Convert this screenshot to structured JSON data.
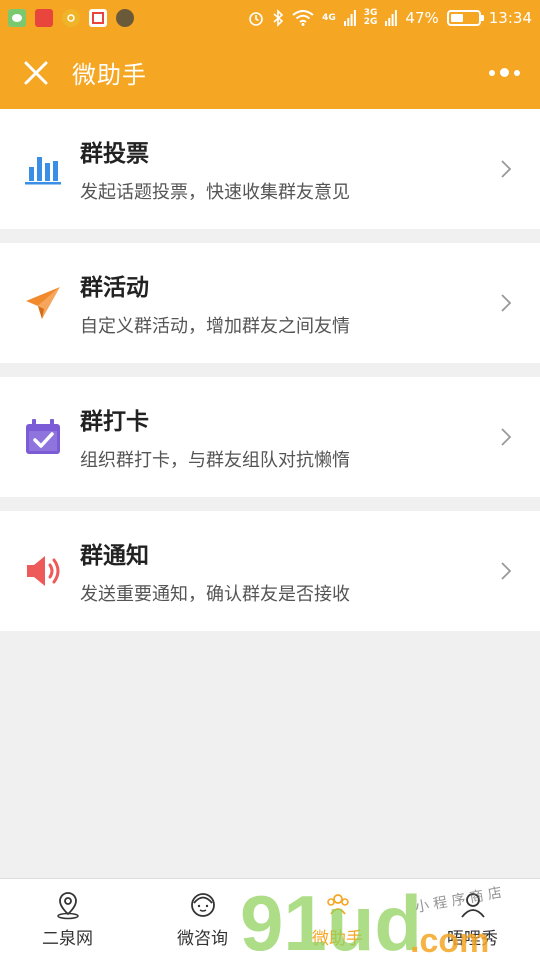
{
  "status_bar": {
    "battery": "47%",
    "battery_level": 0.47,
    "time": "13:34",
    "network1": "4G",
    "network2_top": "3G",
    "network2_bottom": "2G"
  },
  "nav": {
    "title": "微助手"
  },
  "items": [
    {
      "title": "群投票",
      "subtitle": "发起话题投票，快速收集群友意见",
      "icon": "bar-chart-icon",
      "color": "#3a8ee6"
    },
    {
      "title": "群活动",
      "subtitle": "自定义群活动，增加群友之间友情",
      "icon": "paper-plane-icon",
      "color": "#f08a2c"
    },
    {
      "title": "群打卡",
      "subtitle": "组织群打卡，与群友组队对抗懒惰",
      "icon": "calendar-check-icon",
      "color": "#7b5cd6"
    },
    {
      "title": "群通知",
      "subtitle": "发送重要通知，确认群友是否接收",
      "icon": "speaker-icon",
      "color": "#ee5a5a"
    }
  ],
  "tabs": [
    {
      "label": "二泉网",
      "icon": "location-pin-icon"
    },
    {
      "label": "微咨询",
      "icon": "customer-service-icon"
    },
    {
      "label": "微助手",
      "icon": "group-icon",
      "active": true
    },
    {
      "label": "唔哩秀",
      "icon": "user-icon"
    }
  ],
  "watermark": {
    "brand": "91ud",
    "suffix": ".com",
    "tagline": "小 程 序 商 店"
  },
  "colors": {
    "accent": "#f5a623"
  }
}
